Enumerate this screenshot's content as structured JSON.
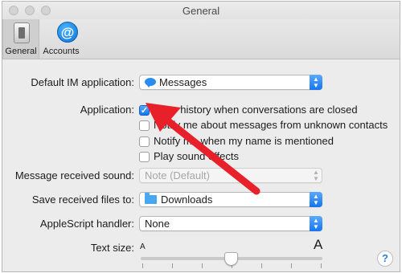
{
  "window": {
    "title": "General"
  },
  "toolbar": {
    "tabs": [
      {
        "label": "General",
        "icon": "switch-icon",
        "selected": true
      },
      {
        "label": "Accounts",
        "icon": "at-icon",
        "selected": false
      }
    ]
  },
  "settings": {
    "default_im_label": "Default IM application:",
    "default_im_value": "Messages",
    "application_label": "Application:",
    "checkboxes": [
      {
        "label": "Save history when conversations are closed",
        "checked": true
      },
      {
        "label": "Notify me about messages from unknown contacts",
        "checked": false
      },
      {
        "label": "Notify me when my name is mentioned",
        "checked": false
      },
      {
        "label": "Play sound effects",
        "checked": false
      }
    ],
    "sound_label": "Message received sound:",
    "sound_value": "Note (Default)",
    "save_files_label": "Save received files to:",
    "save_files_value": "Downloads",
    "applescript_label": "AppleScript handler:",
    "applescript_value": "None",
    "text_size_label": "Text size:",
    "text_size_small": "A",
    "text_size_large": "A",
    "text_size_level": 0.5
  },
  "help": {
    "glyph": "?"
  },
  "colors": {
    "accent": "#1475ec",
    "annotation_arrow": "#e8202a",
    "window_bg": "#ececec"
  }
}
